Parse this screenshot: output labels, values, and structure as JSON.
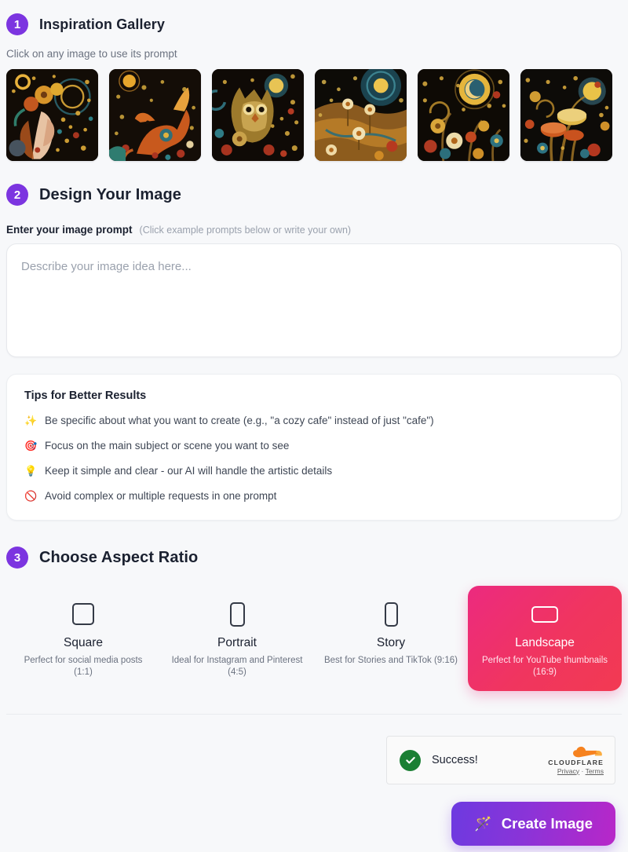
{
  "steps": {
    "one": "1",
    "two": "2",
    "three": "3"
  },
  "gallery": {
    "title": "Inspiration Gallery",
    "hint": "Click on any image to use its prompt",
    "items": [
      {
        "alt": "folk-art woman with sunflower crown under crescent moon"
      },
      {
        "alt": "folk-art ornate fox among flowers and stars"
      },
      {
        "alt": "folk-art owl with moon and blossoms"
      },
      {
        "alt": "folk-art golden hills with daisies under starry sky"
      },
      {
        "alt": "folk-art flower garden with radiant sun spiral"
      },
      {
        "alt": "folk-art mushrooms with glowing sun and vines"
      }
    ]
  },
  "design": {
    "title": "Design Your Image",
    "prompt_label": "Enter your image prompt",
    "prompt_hint": "(Click example prompts below or write your own)",
    "prompt_value": "",
    "prompt_placeholder": "Describe your image idea here...",
    "tips": {
      "title": "Tips for Better Results",
      "items": [
        {
          "icon": "✨",
          "icon_name": "sparkles-icon",
          "text": "Be specific about what you want to create (e.g., \"a cozy cafe\" instead of just \"cafe\")"
        },
        {
          "icon": "🎯",
          "icon_name": "target-icon",
          "text": "Focus on the main subject or scene you want to see"
        },
        {
          "icon": "💡",
          "icon_name": "lightbulb-icon",
          "text": "Keep it simple and clear - our AI will handle the artistic details"
        },
        {
          "icon": "🚫",
          "icon_name": "prohibited-icon",
          "text": "Avoid complex or multiple requests in one prompt"
        }
      ]
    }
  },
  "ratio": {
    "title": "Choose Aspect Ratio",
    "selected": "Landscape",
    "options": [
      {
        "name": "Square",
        "desc": "Perfect for social media posts (1:1)",
        "shape": "sq",
        "selected": false
      },
      {
        "name": "Portrait",
        "desc": "Ideal for Instagram and Pinterest (4:5)",
        "shape": "pt",
        "selected": false
      },
      {
        "name": "Story",
        "desc": "Best for Stories and TikTok (9:16)",
        "shape": "st",
        "selected": false
      },
      {
        "name": "Landscape",
        "desc": "Perfect for YouTube thumbnails (16:9)",
        "shape": "ls",
        "selected": true
      }
    ]
  },
  "turnstile": {
    "status": "Success!",
    "brand": "CLOUDFLARE",
    "privacy": "Privacy",
    "separator": "·",
    "terms": "Terms"
  },
  "cta": {
    "icon": "🪄",
    "label": "Create Image"
  },
  "colors": {
    "step_badge": "#7c35e0",
    "cta_start": "#6d3ae0",
    "cta_end": "#b827c8",
    "selected_ratio_start": "#ec2a7f",
    "selected_ratio_end": "#f23a52",
    "success_green": "#1b7f34",
    "cloudflare_orange": "#f6821f",
    "page_bg": "#f7f8fa"
  }
}
